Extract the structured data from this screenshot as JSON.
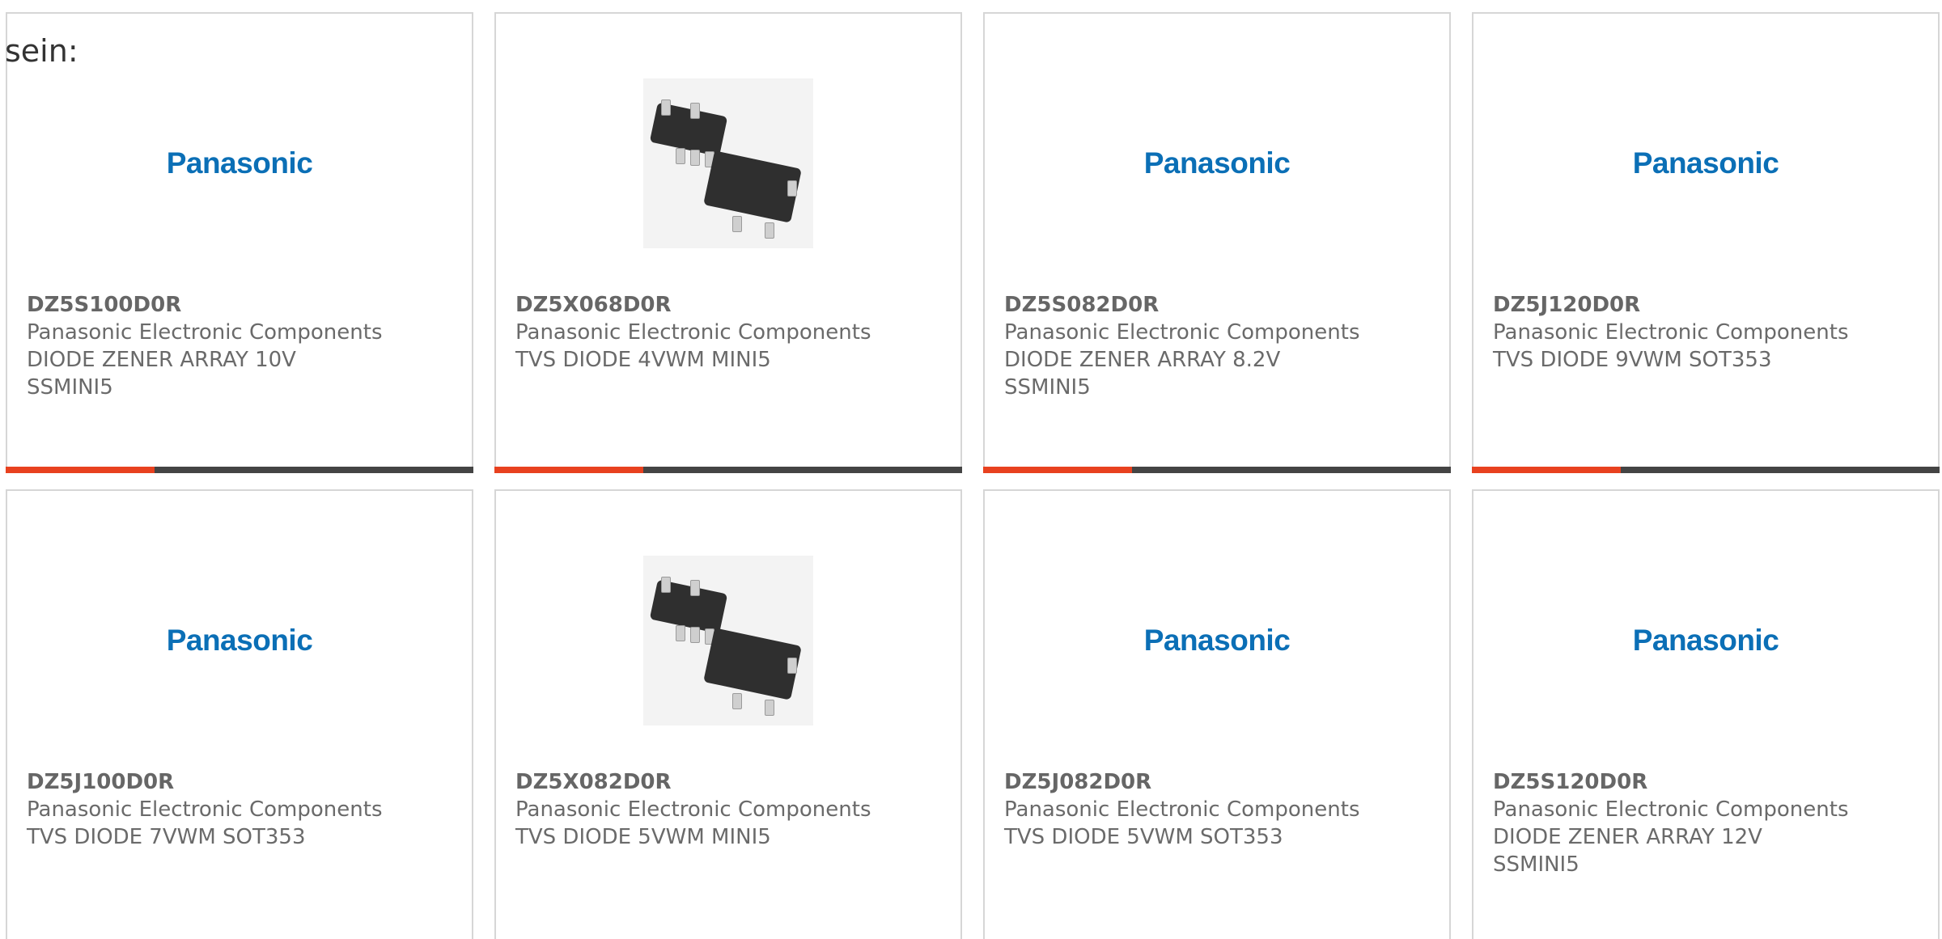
{
  "lead_text": "sein:",
  "colors": {
    "accent": "#e8411f",
    "bar": "#444444",
    "brand": "#0b6fb6",
    "border": "#d6d6d6"
  },
  "products": [
    {
      "part_no": "DZ5S100D0R",
      "manufacturer": "Panasonic Electronic Components",
      "description": "DIODE ZENER ARRAY 10V SSMINI5",
      "image": "panasonic-logo",
      "brand_text": "Panasonic"
    },
    {
      "part_no": "DZ5X068D0R",
      "manufacturer": "Panasonic Electronic Components",
      "description": "TVS DIODE 4VWM MINI5",
      "image": "sot-package-photo",
      "brand_text": ""
    },
    {
      "part_no": "DZ5S082D0R",
      "manufacturer": "Panasonic Electronic Components",
      "description": "DIODE ZENER ARRAY 8.2V SSMINI5",
      "image": "panasonic-logo",
      "brand_text": "Panasonic"
    },
    {
      "part_no": "DZ5J120D0R",
      "manufacturer": "Panasonic Electronic Components",
      "description": "TVS DIODE 9VWM SOT353",
      "image": "panasonic-logo",
      "brand_text": "Panasonic"
    },
    {
      "part_no": "DZ5J100D0R",
      "manufacturer": "Panasonic Electronic Components",
      "description": "TVS DIODE 7VWM SOT353",
      "image": "panasonic-logo",
      "brand_text": "Panasonic"
    },
    {
      "part_no": "DZ5X082D0R",
      "manufacturer": "Panasonic Electronic Components",
      "description": "TVS DIODE 5VWM MINI5",
      "image": "sot-package-photo",
      "brand_text": ""
    },
    {
      "part_no": "DZ5J082D0R",
      "manufacturer": "Panasonic Electronic Components",
      "description": "TVS DIODE 5VWM SOT353",
      "image": "panasonic-logo",
      "brand_text": "Panasonic"
    },
    {
      "part_no": "DZ5S120D0R",
      "manufacturer": "Panasonic Electronic Components",
      "description": "DIODE ZENER ARRAY 12V SSMINI5",
      "image": "panasonic-logo",
      "brand_text": "Panasonic"
    }
  ]
}
